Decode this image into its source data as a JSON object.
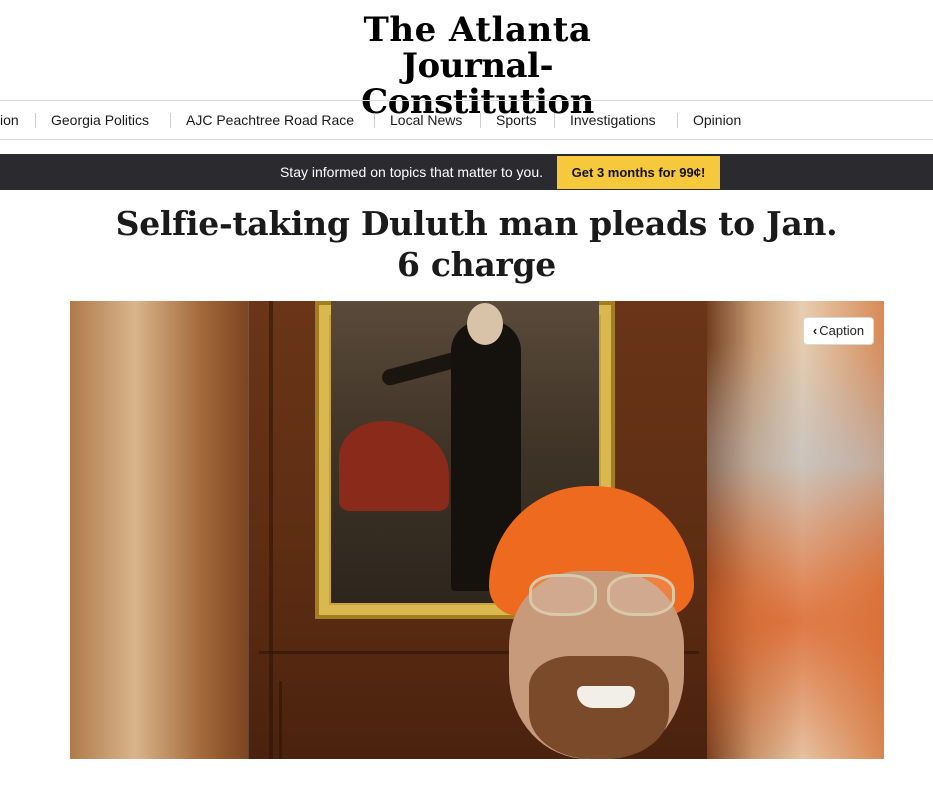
{
  "brand": {
    "logo_line1": "The Atlanta",
    "logo_line2": "Journal-Constitution"
  },
  "nav": {
    "items": [
      {
        "label": "ion"
      },
      {
        "label": "Georgia Politics"
      },
      {
        "label": "AJC Peachtree Road Race"
      },
      {
        "label": "Local News"
      },
      {
        "label": "Sports"
      },
      {
        "label": "Investigations"
      },
      {
        "label": "Opinion"
      }
    ]
  },
  "promo": {
    "message": "Stay informed on topics that matter to you.",
    "cta_label": "Get 3 months for 99¢!"
  },
  "article": {
    "headline": "Selfie-taking Duluth man pleads to Jan. 6 charge",
    "caption_button": "Caption",
    "caption_icon": "chevron-left-icon"
  }
}
